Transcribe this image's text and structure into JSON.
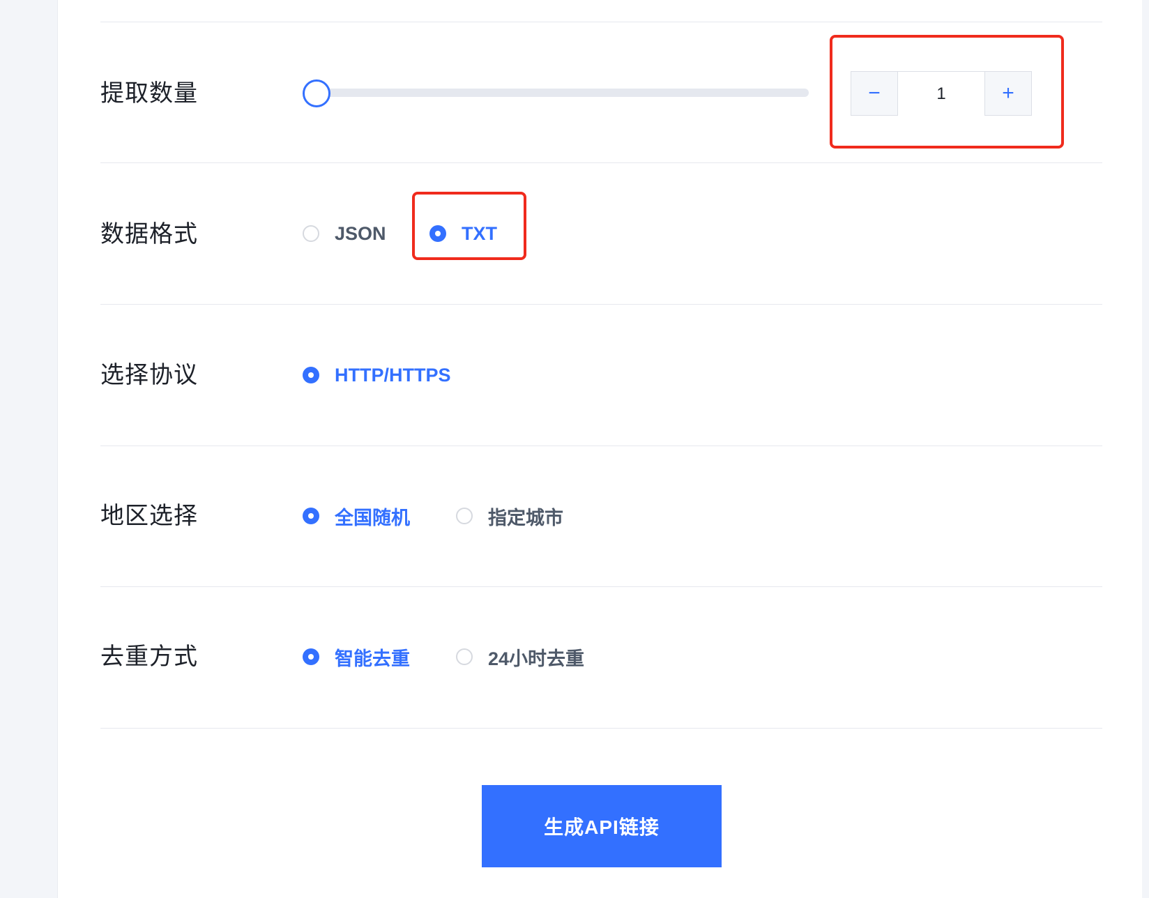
{
  "form": {
    "quantity": {
      "label": "提取数量",
      "value": "1",
      "minus": "−",
      "plus": "+",
      "slider_fraction": 0
    },
    "format": {
      "label": "数据格式",
      "options": [
        {
          "label": "JSON",
          "selected": false
        },
        {
          "label": "TXT",
          "selected": true
        }
      ]
    },
    "protocol": {
      "label": "选择协议",
      "options": [
        {
          "label": "HTTP/HTTPS",
          "selected": true
        }
      ]
    },
    "region": {
      "label": "地区选择",
      "options": [
        {
          "label": "全国随机",
          "selected": true
        },
        {
          "label": "指定城市",
          "selected": false
        }
      ]
    },
    "dedupe": {
      "label": "去重方式",
      "options": [
        {
          "label": "智能去重",
          "selected": true
        },
        {
          "label": "24小时去重",
          "selected": false
        }
      ]
    }
  },
  "generate_button": "生成API链接",
  "colors": {
    "accent": "#3370ff",
    "highlight": "#f02b1d",
    "text": "#1d2129",
    "muted": "#4e5969"
  }
}
